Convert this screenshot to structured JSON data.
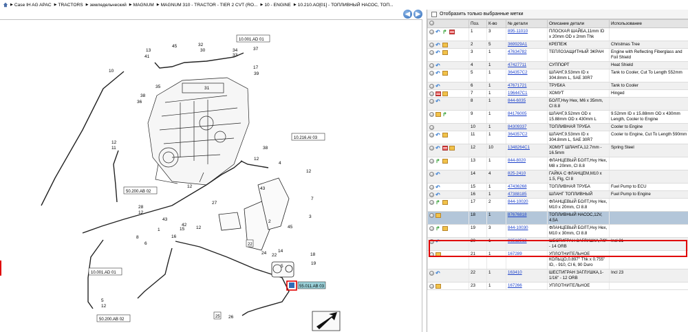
{
  "breadcrumb": [
    "Case IH AG APAC",
    "TRACTORS",
    "земледельческий",
    "MAGNUM",
    "MAGNUM 310 - TRACTOR - TIER 2 CVT (RO...",
    "10 - ENGINE",
    "10.210.AO[01] - ТОПЛИВНЫЙ НАСОС, ТОП..."
  ],
  "nav": {
    "back": "◀",
    "forward": "▶"
  },
  "filter": {
    "label": "Отобразить только выбранные метки"
  },
  "table": {
    "headers": [
      "",
      "Поз.",
      "К-во",
      "№ детали",
      "Описание детали",
      "Использование"
    ],
    "rows": [
      {
        "pos": "1",
        "qty": "3",
        "part": "895-11010",
        "desc": "ПЛОСКАЯ ШАЙБА,11mm ID x 20mm OD x 2mm Thk",
        "use": "",
        "icons": [
          "grey",
          "blue",
          "green",
          "list"
        ]
      },
      {
        "pos": "2",
        "qty": "5",
        "part": "369929A1",
        "desc": "КРЕПЕЖ",
        "use": "Christmas Tree",
        "icons": [
          "grey",
          "blue",
          "box"
        ]
      },
      {
        "pos": "3",
        "qty": "1",
        "part": "47634782",
        "desc": "ТЕПЛОЗАЩИТНЫЙ ЭКРАН",
        "use": "Engine with Reflecting Fiberglass and Foil Shield",
        "icons": [
          "grey",
          "blue",
          "box"
        ]
      },
      {
        "pos": "4",
        "qty": "1",
        "part": "47427711",
        "desc": "СУППОРТ",
        "use": "Heat Shield",
        "icons": [
          "grey",
          "blue"
        ]
      },
      {
        "pos": "5",
        "qty": "1",
        "part": "364357C2",
        "desc": "ШЛАНГ,9.53mm ID x 304.8mm L, SAE 30R7",
        "use": "Tank to Cooler, Cut To Length 552mm",
        "icons": [
          "grey",
          "blue",
          "box"
        ]
      },
      {
        "pos": "6",
        "qty": "1",
        "part": "47671721",
        "desc": "ТРУБКА",
        "use": "Tank to Cooler",
        "icons": [
          "grey",
          "blue"
        ]
      },
      {
        "pos": "7",
        "qty": "1",
        "part": "196447C1",
        "desc": "ХОМУТ",
        "use": "Hinged",
        "icons": [
          "grey",
          "list",
          "box"
        ]
      },
      {
        "pos": "8",
        "qty": "1",
        "part": "844-6035",
        "desc": "БОЛТ,Hvy Hex, M6 x 35mm, Cl 8.8",
        "use": "",
        "icons": [
          "grey",
          "blue"
        ]
      },
      {
        "pos": "9",
        "qty": "1",
        "part": "84176005",
        "desc": "ШЛАНГ,9.52mm OD x 15.88mm OD x 430mm L",
        "use": "9.52mm ID x 15.88mm OD x 430mm Length, Cooler to Engine",
        "icons": [
          "grey",
          "box",
          "green"
        ]
      },
      {
        "pos": "10",
        "qty": "1",
        "part": "84309337",
        "desc": "ТОПЛИВНАЯ ТРУБА",
        "use": "Cooler to Engine",
        "icons": [
          "grey"
        ]
      },
      {
        "pos": "11",
        "qty": "1",
        "part": "364357C2",
        "desc": "ШЛАНГ,9.53mm ID x 304.8mm L, SAE 30R7",
        "use": "Cooler to Engine, Cut To Length 590mm",
        "icons": [
          "grey",
          "blue",
          "box"
        ]
      },
      {
        "pos": "12",
        "qty": "10",
        "part": "1348264C1",
        "desc": "ХОМУТ ШЛАНГА,12.7mm - 16.5mm",
        "use": "Spring Steel",
        "icons": [
          "grey",
          "blue",
          "list",
          "box"
        ]
      },
      {
        "pos": "13",
        "qty": "1",
        "part": "844-8020",
        "desc": "ФЛАНЦЕВЫЙ БОЛТ,Hvy Hex, M8 x 20mm, Cl 8.8",
        "use": "",
        "icons": [
          "grey",
          "green",
          "box"
        ]
      },
      {
        "pos": "14",
        "qty": "4",
        "part": "825-2410",
        "desc": "ГАЙКА С ФЛАНЦЕМ,M10 x 1.5, Flg, Cl 8",
        "use": "",
        "icons": [
          "grey",
          "blue"
        ]
      },
      {
        "pos": "15",
        "qty": "1",
        "part": "47436268",
        "desc": "ТОПЛИВНАЯ ТРУБА",
        "use": "Fuel Pump to ECU",
        "icons": [
          "grey",
          "blue"
        ]
      },
      {
        "pos": "16",
        "qty": "1",
        "part": "47388185",
        "desc": "ШЛАНГ ТОПЛИВНЫЙ",
        "use": "Fuel Pump to Engine",
        "icons": [
          "grey",
          "blue"
        ]
      },
      {
        "pos": "17",
        "qty": "2",
        "part": "844-10020",
        "desc": "ФЛАНЦЕВЫЙ БОЛТ,Hvy Hex, M10 x 20mm, Cl 8.8",
        "use": "",
        "icons": [
          "grey",
          "green",
          "box"
        ]
      },
      {
        "pos": "18",
        "qty": "1",
        "part": "87676818",
        "desc": "ТОПЛИВНЫЙ НАСОС,12V, 4.5A",
        "use": "",
        "icons": [
          "grey",
          "box"
        ],
        "selected": true
      },
      {
        "pos": "19",
        "qty": "3",
        "part": "844-10030",
        "desc": "ФЛАНЦЕВЫЙ БОЛТ,Hvy Hex, M10 x 30mm, Cl 8.8",
        "use": "",
        "icons": [
          "grey",
          "green",
          "box"
        ]
      },
      {
        "pos": "20",
        "qty": "1",
        "part": "86512512",
        "desc": "ШЕСТИГРАН ЗАГЛУШКА,7/8\" - 14 ORB",
        "use": "Incl 21",
        "icons": [
          "grey",
          "blue"
        ]
      },
      {
        "pos": "21",
        "qty": "1",
        "part": "167289",
        "desc": "УПЛОТНИТЕЛЬНОЕ КОЛЬЦО,0.897\" Thk x 0.755\" ID, - 910, Cl 6, 90 Duro",
        "use": "",
        "icons": [
          "grey",
          "box"
        ]
      },
      {
        "pos": "22",
        "qty": "1",
        "part": "163410",
        "desc": "ШЕСТИГРАН ЗАГЛУШКА,1-1/16\" - 12 ORB",
        "use": "Incl 23",
        "icons": [
          "grey",
          "blue"
        ]
      },
      {
        "pos": "23",
        "qty": "1",
        "part": "167266",
        "desc": "УПЛОТНИТЕЛЬНОЕ",
        "use": "",
        "icons": [
          "grey",
          "box"
        ]
      }
    ]
  },
  "callouts": [
    "13",
    "41",
    "45",
    "32",
    "30",
    "10.001.AD 01",
    "34",
    "33",
    "37",
    "17",
    "39",
    "10",
    "38",
    "36",
    "35",
    "31",
    "12",
    "11",
    "10.216.AI 03",
    "27",
    "12",
    "50.200.AB 02",
    "28",
    "12",
    "43",
    "1",
    "42",
    "12",
    "2",
    "45",
    "4",
    "7",
    "3",
    "18",
    "19",
    "8",
    "6",
    "16",
    "15",
    "22",
    "10.001.AD 01",
    "5",
    "12",
    "50.200.AB 02",
    "25",
    "26",
    "20",
    "55.011.AB 03"
  ]
}
